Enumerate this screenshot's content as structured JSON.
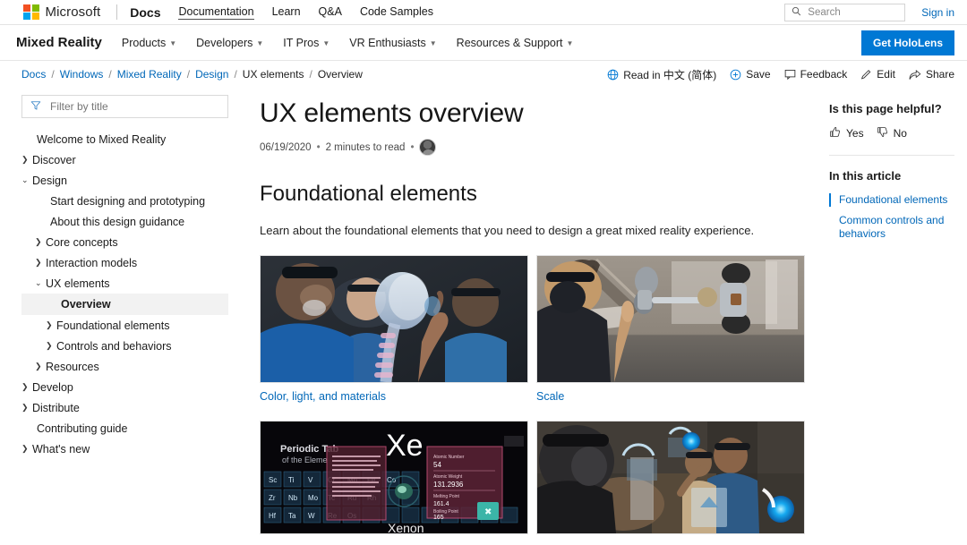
{
  "topbar": {
    "ms_name": "Microsoft",
    "docs_brand": "Docs",
    "nav": [
      {
        "label": "Documentation",
        "active": true
      },
      {
        "label": "Learn",
        "active": false
      },
      {
        "label": "Q&A",
        "active": false
      },
      {
        "label": "Code Samples",
        "active": false
      }
    ],
    "search_placeholder": "Search",
    "signin": "Sign in"
  },
  "productbar": {
    "title": "Mixed Reality",
    "nav": [
      {
        "label": "Products"
      },
      {
        "label": "Developers"
      },
      {
        "label": "IT Pros"
      },
      {
        "label": "VR Enthusiasts"
      },
      {
        "label": "Resources & Support"
      }
    ],
    "cta": "Get HoloLens",
    "cta_color": "#0078d4"
  },
  "breadcrumb": {
    "items": [
      {
        "label": "Docs",
        "link": true
      },
      {
        "label": "Windows",
        "link": true
      },
      {
        "label": "Mixed Reality",
        "link": true
      },
      {
        "label": "Design",
        "link": true
      },
      {
        "label": "UX elements",
        "link": false
      },
      {
        "label": "Overview",
        "link": false
      }
    ],
    "separator": "/"
  },
  "actions": [
    {
      "label": "Read in 中文 (简体)",
      "icon": "globe-icon"
    },
    {
      "label": "Save",
      "icon": "plus-circle-icon"
    },
    {
      "label": "Feedback",
      "icon": "comment-icon"
    },
    {
      "label": "Edit",
      "icon": "pencil-icon"
    },
    {
      "label": "Share",
      "icon": "share-icon"
    }
  ],
  "sidebar": {
    "filter_placeholder": "Filter by title",
    "filter_value": "",
    "items": [
      {
        "label": "Welcome to Mixed Reality",
        "level": 0,
        "chevron": "none",
        "selected": false
      },
      {
        "label": "Discover",
        "level": 0,
        "chevron": "right",
        "selected": false
      },
      {
        "label": "Design",
        "level": 0,
        "chevron": "down",
        "selected": false
      },
      {
        "label": "Start designing and prototyping",
        "level": 1,
        "chevron": "none",
        "selected": false
      },
      {
        "label": "About this design guidance",
        "level": 1,
        "chevron": "none",
        "selected": false
      },
      {
        "label": "Core concepts",
        "level": 1,
        "chevron": "right",
        "selected": false
      },
      {
        "label": "Interaction models",
        "level": 1,
        "chevron": "right",
        "selected": false
      },
      {
        "label": "UX elements",
        "level": 1,
        "chevron": "down",
        "selected": false
      },
      {
        "label": "Overview",
        "level": 2,
        "chevron": "none",
        "selected": true
      },
      {
        "label": "Foundational elements",
        "level": 2,
        "chevron": "right",
        "selected": false
      },
      {
        "label": "Controls and behaviors",
        "level": 2,
        "chevron": "right",
        "selected": false
      },
      {
        "label": "Resources",
        "level": 1,
        "chevron": "right",
        "selected": false
      },
      {
        "label": "Develop",
        "level": 0,
        "chevron": "right",
        "selected": false
      },
      {
        "label": "Distribute",
        "level": 0,
        "chevron": "right",
        "selected": false
      },
      {
        "label": "Contributing guide",
        "level": 0,
        "chevron": "none",
        "selected": false
      },
      {
        "label": "What's new",
        "level": 0,
        "chevron": "right",
        "selected": false
      }
    ]
  },
  "article": {
    "title": "UX elements overview",
    "date": "06/19/2020",
    "read_time": "2 minutes to read",
    "meta_sep": "•",
    "section_heading": "Foundational elements",
    "lede": "Learn about the foundational elements that you need to design a great mixed reality experience.",
    "cards": [
      {
        "caption": "Color, light, and materials",
        "image": "surgeons-hololens-anatomy-hologram"
      },
      {
        "caption": "Scale",
        "image": "hololens-user-car-chassis-hologram"
      },
      {
        "caption": "",
        "image": "periodic-table-xenon-hologram"
      },
      {
        "caption": "",
        "image": "factory-workers-hololens-blue-markers"
      }
    ]
  },
  "rail": {
    "helpful_heading": "Is this page helpful?",
    "yes": "Yes",
    "no": "No",
    "in_this_article": "In this article",
    "links": [
      {
        "label": "Foundational elements",
        "active": true
      },
      {
        "label": "Common controls and behaviors",
        "active": false
      }
    ],
    "accent": "#0078d4"
  }
}
